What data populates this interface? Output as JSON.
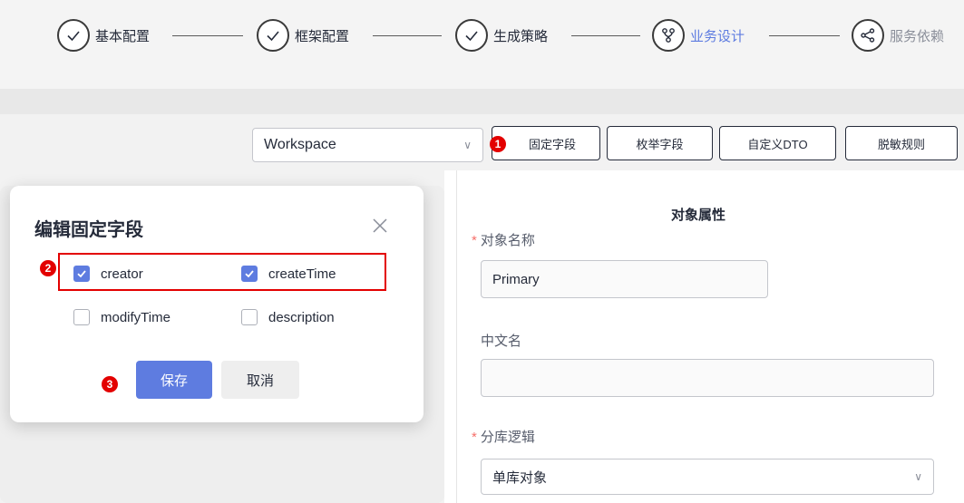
{
  "steps": [
    {
      "label": "基本配置",
      "state": "done"
    },
    {
      "label": "框架配置",
      "state": "done"
    },
    {
      "label": "生成策略",
      "state": "done"
    },
    {
      "label": "业务设计",
      "state": "active"
    },
    {
      "label": "服务依赖",
      "state": "pending"
    }
  ],
  "toolbar": {
    "workspace_select": "Workspace",
    "fixed_fields_btn": "固定字段",
    "enum_fields_btn": "枚举字段",
    "custom_dto_btn": "自定义DTO",
    "masking_rules_btn": "脱敏规则"
  },
  "object_panel": {
    "title": "对象属性",
    "object_name_label": "对象名称",
    "object_name_value": "Primary",
    "chinese_name_label": "中文名",
    "chinese_name_value": "",
    "sharding_label": "分库逻辑",
    "sharding_value": "单库对象"
  },
  "modal": {
    "title": "编辑固定字段",
    "fields": [
      {
        "label": "creator",
        "checked": true
      },
      {
        "label": "createTime",
        "checked": true
      },
      {
        "label": "modifyTime",
        "checked": false
      },
      {
        "label": "description",
        "checked": false
      }
    ],
    "save_label": "保存",
    "cancel_label": "取消"
  },
  "annotations": {
    "badge1": "1",
    "badge2": "2",
    "badge3": "3"
  },
  "colors": {
    "primary": "#5e7ce0",
    "annotation_red": "#e30000",
    "required_star": "#f66f6a"
  }
}
